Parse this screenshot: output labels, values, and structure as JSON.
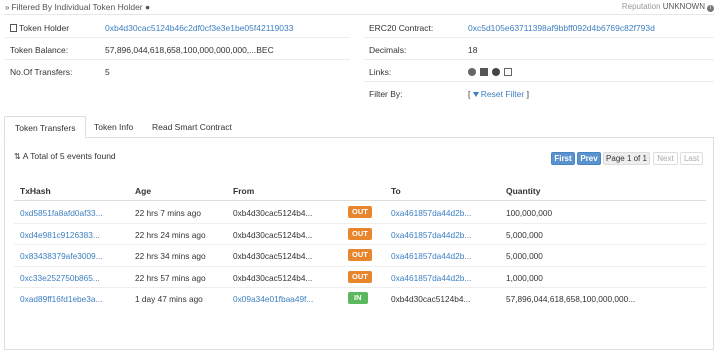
{
  "header": {
    "filter_title": "Filtered By Individual Token Holder",
    "reputation_label": "Reputation",
    "reputation_value": "UNKNOWN"
  },
  "summary_left": [
    {
      "label": "Token Holder",
      "value": "0xb4d30cac5124b46c2df0cf3e3e1be05f42119033",
      "is_link": true
    },
    {
      "label": "Token Balance:",
      "value": "57,896,044,618,658,100,000,000,000,...BEC",
      "is_link": false
    },
    {
      "label": "No.Of Transfers:",
      "value": "5",
      "is_link": false
    }
  ],
  "summary_right": {
    "contract_label": "ERC20 Contract:",
    "contract_value": "0xc5d105e63711398af9bbff092d4b6769c82f793d",
    "decimals_label": "Decimals:",
    "decimals_value": "18",
    "links_label": "Links:",
    "filter_label": "Filter By:",
    "filter_open": "[",
    "filter_reset": "Reset Filter",
    "filter_close": "]"
  },
  "tabs": [
    {
      "label": "Token Transfers",
      "active": true
    },
    {
      "label": "Token Info",
      "active": false
    },
    {
      "label": "Read Smart Contract",
      "active": false
    }
  ],
  "events_text": "A Total of 5 events found",
  "pager": {
    "first": "First",
    "prev": "Prev",
    "page": "Page 1 of 1",
    "next": "Next",
    "last": "Last"
  },
  "table": {
    "columns": [
      "TxHash",
      "Age",
      "From",
      "",
      "To",
      "Quantity"
    ],
    "rows": [
      {
        "hash": "0xd5851fa8afd0af33...",
        "age": "22 hrs 7 mins ago",
        "from": "0xb4d30cac5124b4...",
        "dir": "OUT",
        "to": "0xa461857da44d2b...",
        "qty": "100,000,000"
      },
      {
        "hash": "0xd4e981c9126383...",
        "age": "22 hrs 24 mins ago",
        "from": "0xb4d30cac5124b4...",
        "dir": "OUT",
        "to": "0xa461857da44d2b...",
        "qty": "5,000,000"
      },
      {
        "hash": "0x83438379afe3009...",
        "age": "22 hrs 34 mins ago",
        "from": "0xb4d30cac5124b4...",
        "dir": "OUT",
        "to": "0xa461857da44d2b...",
        "qty": "5,000,000"
      },
      {
        "hash": "0xc33e252750b865...",
        "age": "22 hrs 57 mins ago",
        "from": "0xb4d30cac5124b4...",
        "dir": "OUT",
        "to": "0xa461857da44d2b...",
        "qty": "1,000,000"
      },
      {
        "hash": "0xad89ff16fd1ebe3a...",
        "age": "1 day 47 mins ago",
        "from": "0x09a34e01fbaa49f...",
        "dir": "IN",
        "to": "0xb4d30cac5124b4...",
        "qty": "57,896,044,618,658,100,000,000..."
      }
    ]
  },
  "colors": {
    "link": "#3d7fc1",
    "out_badge": "#e8862e",
    "in_badge": "#5cb85c",
    "pager_primary": "#5a93cd"
  }
}
